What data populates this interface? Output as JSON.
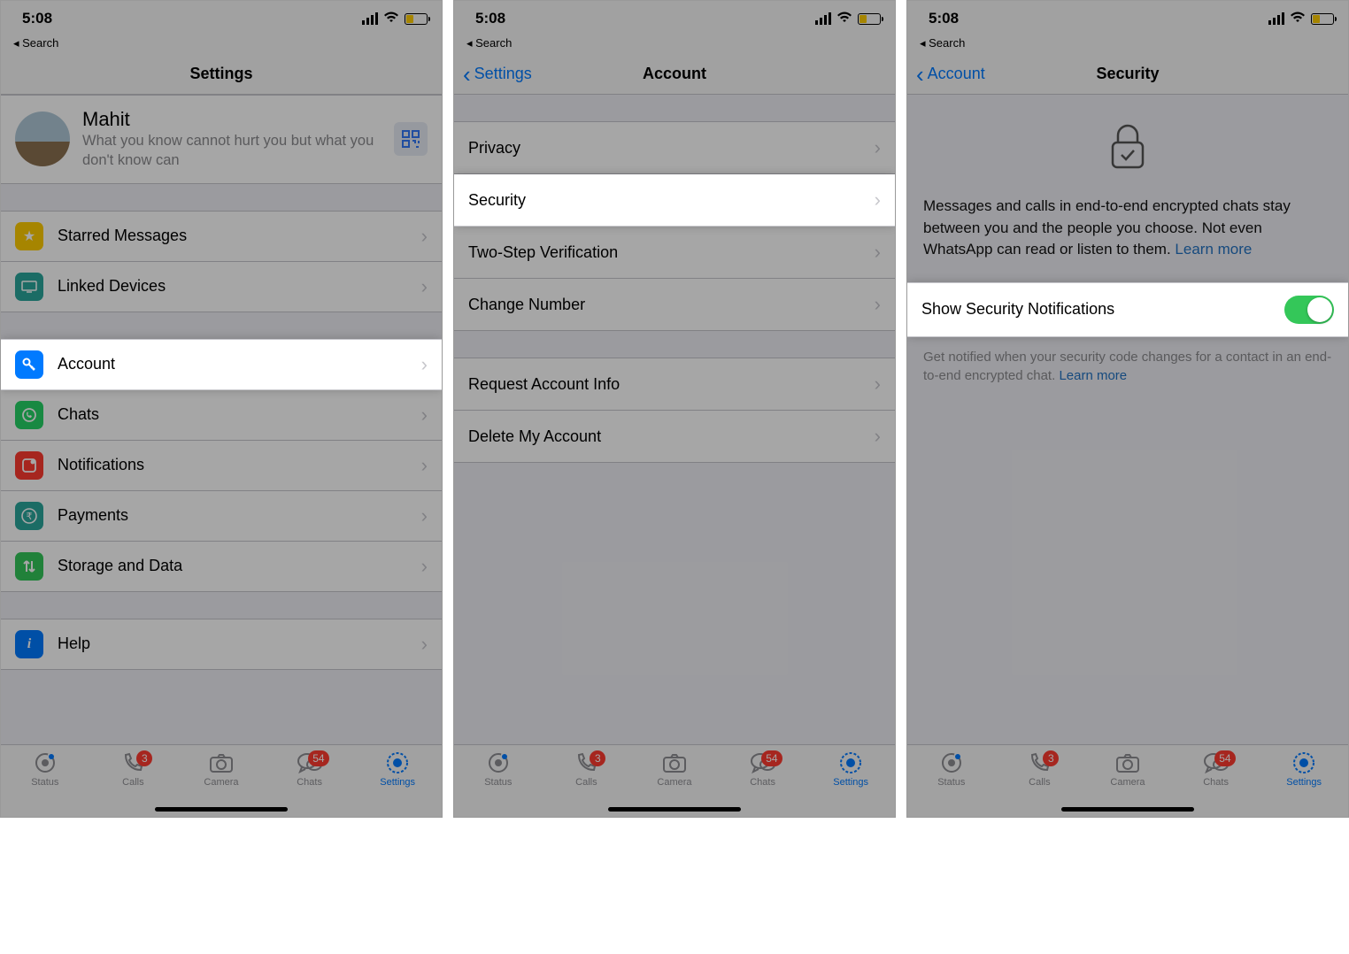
{
  "statusbar": {
    "time": "5:08",
    "back_search": "◂ Search"
  },
  "s1": {
    "nav_title": "Settings",
    "profile": {
      "name": "Mahit",
      "status": "What you know cannot hurt you but what you don't know can"
    },
    "g1": [
      {
        "label": "Starred Messages",
        "color": "ic-yellow",
        "glyph": "★"
      },
      {
        "label": "Linked Devices",
        "color": "ic-teal",
        "glyph": "⌂"
      }
    ],
    "g2": [
      {
        "label": "Account",
        "color": "ic-blue",
        "glyph": "🔑",
        "highlight": true
      },
      {
        "label": "Chats",
        "color": "ic-green",
        "glyph": "💬"
      },
      {
        "label": "Notifications",
        "color": "ic-red",
        "glyph": "🔔"
      },
      {
        "label": "Payments",
        "color": "ic-teal",
        "glyph": "₹"
      },
      {
        "label": "Storage and Data",
        "color": "ic-green2",
        "glyph": "↕"
      }
    ],
    "g3": [
      {
        "label": "Help",
        "color": "ic-blue",
        "glyph": "i"
      }
    ]
  },
  "s2": {
    "nav_back": "Settings",
    "nav_title": "Account",
    "g1": [
      {
        "label": "Privacy"
      },
      {
        "label": "Security",
        "highlight": true
      },
      {
        "label": "Two-Step Verification"
      },
      {
        "label": "Change Number"
      }
    ],
    "g2": [
      {
        "label": "Request Account Info"
      },
      {
        "label": "Delete My Account"
      }
    ]
  },
  "s3": {
    "nav_back": "Account",
    "nav_title": "Security",
    "desc": "Messages and calls in end-to-end encrypted chats stay between you and the people you choose. Not even WhatsApp can read or listen to them. ",
    "learn_more": "Learn more",
    "toggle_label": "Show Security Notifications",
    "footer": "Get notified when your security code changes for a contact in an end-to-end encrypted chat. ",
    "footer_learn": "Learn more"
  },
  "tabs": {
    "status": "Status",
    "calls": "Calls",
    "calls_badge": "3",
    "camera": "Camera",
    "chats": "Chats",
    "chats_badge": "54",
    "settings": "Settings"
  }
}
